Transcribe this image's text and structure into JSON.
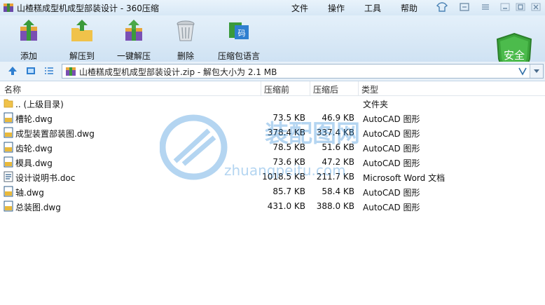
{
  "window": {
    "title": "山楂糕成型机成型部装设计 - 360压缩",
    "menu": [
      "文件",
      "操作",
      "工具",
      "帮助"
    ]
  },
  "toolbar": {
    "buttons": [
      {
        "label": "添加",
        "icon": "add-archive-icon"
      },
      {
        "label": "解压到",
        "icon": "extract-to-icon"
      },
      {
        "label": "一键解压",
        "icon": "one-click-extract-icon"
      },
      {
        "label": "删除",
        "icon": "trash-icon"
      },
      {
        "label": "压缩包语言",
        "icon": "archive-language-icon"
      }
    ],
    "security_badge": "安全"
  },
  "address": {
    "path": "山楂糕成型机成型部装设计.zip - 解包大小为 2.1 MB"
  },
  "columns": {
    "name": "名称",
    "compressed": "压缩前",
    "uncompressed": "压缩后",
    "type": "类型"
  },
  "files": [
    {
      "name": ".. (上级目录)",
      "before": "",
      "after": "",
      "type": "文件夹",
      "icon": "folder-icon"
    },
    {
      "name": "槽轮.dwg",
      "before": "73.5 KB",
      "after": "46.9 KB",
      "type": "AutoCAD 图形",
      "icon": "dwg-file-icon"
    },
    {
      "name": "成型装置部装图.dwg",
      "before": "378.4 KB",
      "after": "337.4 KB",
      "type": "AutoCAD 图形",
      "icon": "dwg-file-icon"
    },
    {
      "name": "齿轮.dwg",
      "before": "78.5 KB",
      "after": "51.6 KB",
      "type": "AutoCAD 图形",
      "icon": "dwg-file-icon"
    },
    {
      "name": "模具.dwg",
      "before": "73.6 KB",
      "after": "47.2 KB",
      "type": "AutoCAD 图形",
      "icon": "dwg-file-icon"
    },
    {
      "name": "设计说明书.doc",
      "before": "1018.5 KB",
      "after": "211.7 KB",
      "type": "Microsoft Word 文档",
      "icon": "doc-file-icon"
    },
    {
      "name": "轴.dwg",
      "before": "85.7 KB",
      "after": "58.4 KB",
      "type": "AutoCAD 图形",
      "icon": "dwg-file-icon"
    },
    {
      "name": "总装图.dwg",
      "before": "431.0 KB",
      "after": "388.0 KB",
      "type": "AutoCAD 图形",
      "icon": "dwg-file-icon"
    }
  ],
  "watermark": {
    "text_cn": "装配图网",
    "text_url": "zhuangpeitu.com"
  }
}
